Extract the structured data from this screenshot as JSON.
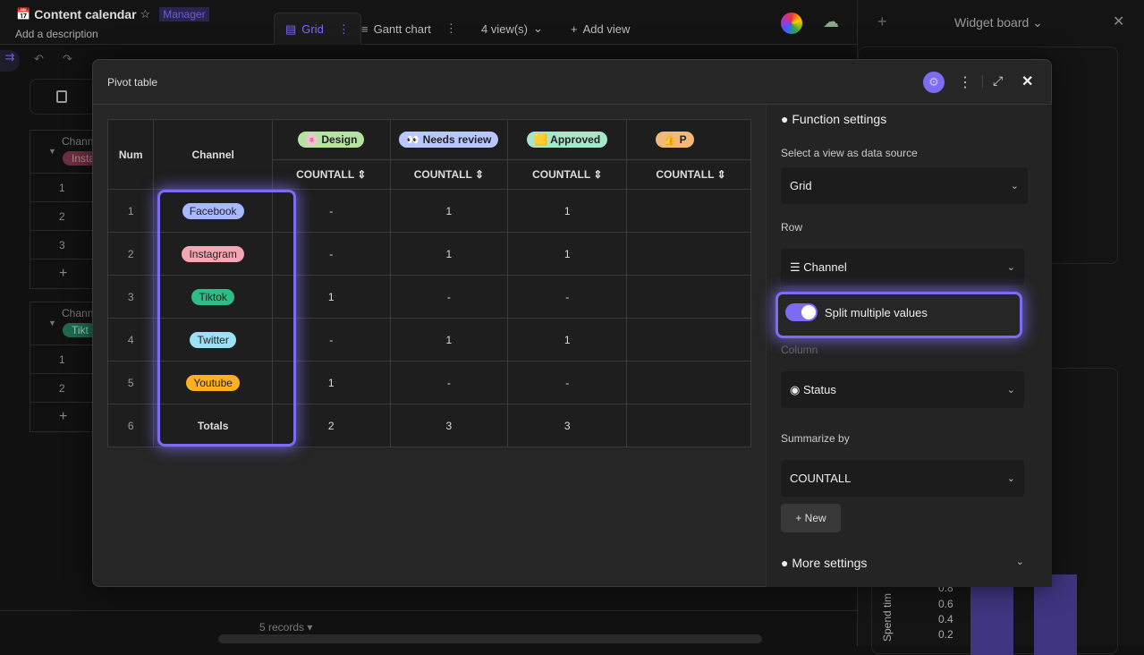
{
  "app": {
    "icon": "calendar-icon",
    "title": "Content calendar",
    "role_badge": "Manager",
    "description": "Add a description"
  },
  "views": {
    "tabs": [
      {
        "label": "Grid",
        "icon": "grid-icon"
      },
      {
        "label": "Gantt chart",
        "icon": "gantt-icon"
      }
    ],
    "count_label": "4 view(s)",
    "add_label": "Add view"
  },
  "background_grid": {
    "groups": [
      {
        "field": "Chann",
        "value": "Insta",
        "color": "#7a3a48",
        "rows": [
          "1",
          "2",
          "3"
        ]
      },
      {
        "field": "Chann",
        "value": "Tikt",
        "color": "#2a7a5a",
        "rows": [
          "1",
          "2"
        ]
      }
    ],
    "records_label": "5 records"
  },
  "widget_board": {
    "title": "Widget board",
    "chart_ylabel": "Spend tim",
    "ticks": [
      "0.2",
      "0.4",
      "0.6",
      "0.8"
    ]
  },
  "modal": {
    "title": "Pivot table",
    "table": {
      "headers": {
        "num": "Num",
        "channel": "Channel"
      },
      "status_columns": [
        {
          "label": "Design",
          "emoji": "🌸",
          "color": "#b6e3a0"
        },
        {
          "label": "Needs review",
          "emoji": "👀",
          "color": "#b8c8ff"
        },
        {
          "label": "Approved",
          "emoji": "🟨",
          "color": "#a8e6c8"
        },
        {
          "label": "P",
          "emoji": "👍",
          "color": "#f5b878"
        }
      ],
      "agg_label": "COUNTALL",
      "rows": [
        {
          "num": "1",
          "channel": "Facebook",
          "color": "#a9b9ff",
          "values": [
            "-",
            "1",
            "1"
          ]
        },
        {
          "num": "2",
          "channel": "Instagram",
          "color": "#f4a6b4",
          "values": [
            "-",
            "1",
            "1"
          ]
        },
        {
          "num": "3",
          "channel": "Tiktok",
          "color": "#2ebd85",
          "values": [
            "1",
            "-",
            "-"
          ]
        },
        {
          "num": "4",
          "channel": "Twitter",
          "color": "#9ee0f7",
          "values": [
            "-",
            "1",
            "1"
          ]
        },
        {
          "num": "5",
          "channel": "Youtube",
          "color": "#ffb020",
          "values": [
            "1",
            "-",
            "-"
          ]
        }
      ],
      "totals": {
        "num": "6",
        "label": "Totals",
        "values": [
          "2",
          "3",
          "3"
        ]
      }
    },
    "settings": {
      "section_title": "Function settings",
      "data_source_label": "Select a view as data source",
      "data_source_value": "Grid",
      "row_label": "Row",
      "row_value": "Channel",
      "split_label": "Split multiple values",
      "split_on": true,
      "column_label": "Column",
      "column_value": "Status",
      "summarize_label": "Summarize by",
      "summarize_value": "COUNTALL",
      "new_button": "+ New",
      "more_settings": "More settings"
    }
  },
  "colors": {
    "accent": "#7c6cf2"
  }
}
